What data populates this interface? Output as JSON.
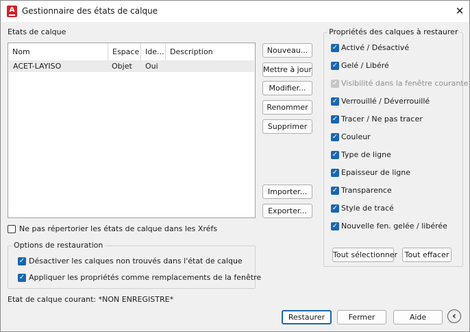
{
  "window": {
    "title": "Gestionnaire des états de calque",
    "app_icon_letter": "A",
    "close_glyph": "✕"
  },
  "states": {
    "label": "Etats de calque",
    "columns": [
      "Nom",
      "Espace",
      "Ide...",
      "Description"
    ],
    "rows": [
      {
        "nom": "ACET-LAYISO",
        "espace": "Objet",
        "ide": "Oui",
        "description": ""
      }
    ]
  },
  "buttons": {
    "nouveau": "Nouveau...",
    "mettre_a_jour": "Mettre à jour",
    "modifier": "Modifier...",
    "renommer": "Renommer",
    "supprimer": "Supprimer",
    "importer": "Importer...",
    "exporter": "Exporter..."
  },
  "ne_pas_repertorier": {
    "label": "Ne pas répertorier les états de calque dans les Xréfs",
    "checked": false
  },
  "options": {
    "label": "Options de restauration",
    "items": [
      {
        "label": "Désactiver les calques non trouvés dans l'état de calque",
        "checked": true
      },
      {
        "label": "Appliquer les propriétés comme remplacements de la fenêtre",
        "checked": true
      }
    ]
  },
  "current_state": "Etat de calque courant: *NON ENREGISTRE*",
  "properties": {
    "label": "Propriétés des calques à restaurer",
    "items": [
      {
        "label": "Activé / Désactivé",
        "checked": true,
        "disabled": false
      },
      {
        "label": "Gelé / Libéré",
        "checked": true,
        "disabled": false
      },
      {
        "label": "Visibilité dans la fenêtre courante",
        "checked": true,
        "disabled": true
      },
      {
        "label": "Verrouillé / Déverrouillé",
        "checked": true,
        "disabled": false
      },
      {
        "label": "Tracer / Ne pas tracer",
        "checked": true,
        "disabled": false
      },
      {
        "label": "Couleur",
        "checked": true,
        "disabled": false
      },
      {
        "label": "Type de ligne",
        "checked": true,
        "disabled": false
      },
      {
        "label": "Epaisseur de ligne",
        "checked": true,
        "disabled": false
      },
      {
        "label": "Transparence",
        "checked": true,
        "disabled": false
      },
      {
        "label": "Style de tracé",
        "checked": true,
        "disabled": false
      },
      {
        "label": "Nouvelle fen. gelée / libérée",
        "checked": true,
        "disabled": false
      }
    ],
    "select_all": "Tout sélectionner",
    "clear_all": "Tout effacer"
  },
  "footer": {
    "restaurer": "Restaurer",
    "fermer": "Fermer",
    "aide": "Aide",
    "nav_glyph": "‹"
  },
  "colors": {
    "accent": "#1a66b0",
    "app_icon": "#d4222a"
  }
}
